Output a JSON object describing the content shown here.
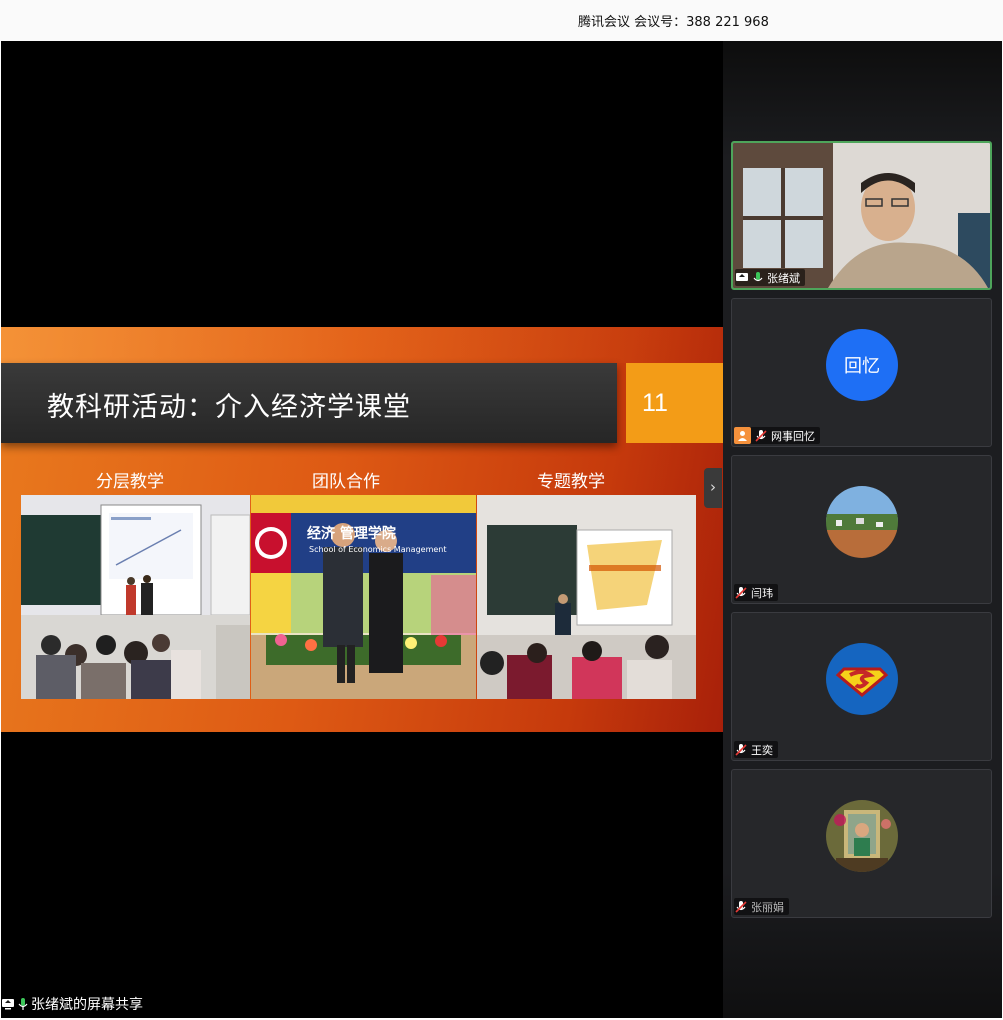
{
  "app": {
    "title": "腾讯会议  会议号：388 221 968"
  },
  "slide": {
    "title": "教科研活动：介入经济学课堂",
    "page_number": "11",
    "captions": [
      "分层教学",
      "团队合作",
      "专题教学"
    ],
    "banner_text": "经济  管理学院",
    "banner_subtext": "School of Economics Management"
  },
  "share": {
    "label": "张绪斌的屏幕共享"
  },
  "participants": [
    {
      "name": "张绪斌",
      "kind": "video",
      "mic": "on"
    },
    {
      "name": "网事回忆",
      "kind": "text-avatar",
      "avatar_text": "回忆",
      "avatar_color": "#1e6ff5",
      "mic": "off"
    },
    {
      "name": "闫玮",
      "kind": "photo-avatar",
      "mic": "off"
    },
    {
      "name": "王奕",
      "kind": "superman-avatar",
      "avatar_color": "#1565c0",
      "mic": "off"
    },
    {
      "name": "张丽娟",
      "kind": "photo-avatar",
      "mic": "off"
    }
  ],
  "colors": {
    "accent_orange": "#f39c17",
    "active_border": "#4ea55b",
    "tile_bg": "#26272a"
  }
}
